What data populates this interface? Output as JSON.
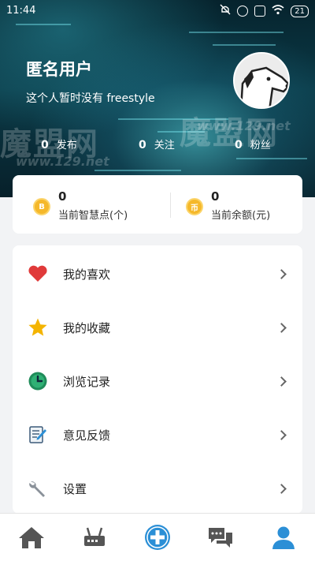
{
  "status_bar": {
    "time": "11:44",
    "battery": "21",
    "icons": [
      "mute-icon",
      "alarm-icon",
      "close-box-icon",
      "wifi-icon",
      "battery-icon"
    ]
  },
  "profile": {
    "username": "匿名用户",
    "bio": "这个人暂时没有 freestyle",
    "stats": [
      {
        "value": "0",
        "label": "发布"
      },
      {
        "value": "0",
        "label": "关注"
      },
      {
        "value": "0",
        "label": "粉丝"
      }
    ],
    "watermark_text": "魔盟网",
    "watermark_url": "www.129.net"
  },
  "points": [
    {
      "value": "0",
      "label": "当前智慧点(个)",
      "coin_glyph": "B",
      "icon": "coin-icon"
    },
    {
      "value": "0",
      "label": "当前余额(元)",
      "coin_glyph": "币",
      "icon": "balance-coin-icon"
    }
  ],
  "menu": [
    {
      "label": "我的喜欢",
      "icon": "heart-icon"
    },
    {
      "label": "我的收藏",
      "icon": "star-icon"
    },
    {
      "label": "浏览记录",
      "icon": "clock-icon"
    },
    {
      "label": "意见反馈",
      "icon": "feedback-icon"
    },
    {
      "label": "设置",
      "icon": "wrench-icon"
    }
  ],
  "bottom_nav": [
    {
      "icon": "home-icon"
    },
    {
      "icon": "router-icon"
    },
    {
      "icon": "add-icon"
    },
    {
      "icon": "chat-icon"
    },
    {
      "icon": "profile-icon",
      "active": true
    }
  ],
  "colors": {
    "accent": "#2b8fd6",
    "coin": "#f5b82a",
    "heart": "#e03a3a",
    "star": "#f4b400",
    "clock": "#1f8c5a"
  }
}
